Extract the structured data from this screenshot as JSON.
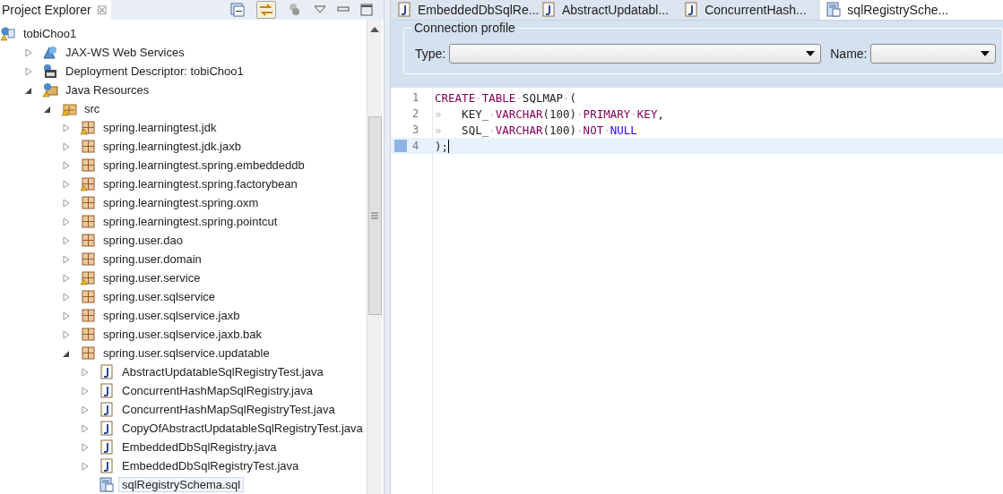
{
  "explorer": {
    "title": "Project Explorer",
    "close": "☒",
    "tree": [
      {
        "label": "tobiChoo1",
        "kind": "project",
        "expandable": false,
        "selected": false,
        "children": [
          {
            "label": "JAX-WS Web Services",
            "kind": "webservices",
            "expanded": false,
            "selected": false
          },
          {
            "label": "Deployment Descriptor: tobiChoo1",
            "kind": "descriptor",
            "expanded": false,
            "selected": false
          },
          {
            "label": "Java Resources",
            "kind": "resources",
            "expanded": true,
            "selected": false,
            "children": [
              {
                "label": "src",
                "kind": "src",
                "expanded": true,
                "selected": false,
                "children": [
                  {
                    "label": "spring.learningtest.jdk",
                    "kind": "package-warn",
                    "expanded": false,
                    "selected": false
                  },
                  {
                    "label": "spring.learningtest.jdk.jaxb",
                    "kind": "package",
                    "expanded": false,
                    "selected": false
                  },
                  {
                    "label": "spring.learningtest.spring.embeddeddb",
                    "kind": "package",
                    "expanded": false,
                    "selected": false
                  },
                  {
                    "label": "spring.learningtest.spring.factorybean",
                    "kind": "package-warn",
                    "expanded": false,
                    "selected": false
                  },
                  {
                    "label": "spring.learningtest.spring.oxm",
                    "kind": "package",
                    "expanded": false,
                    "selected": false
                  },
                  {
                    "label": "spring.learningtest.spring.pointcut",
                    "kind": "package",
                    "expanded": false,
                    "selected": false
                  },
                  {
                    "label": "spring.user.dao",
                    "kind": "package",
                    "expanded": false,
                    "selected": false
                  },
                  {
                    "label": "spring.user.domain",
                    "kind": "package",
                    "expanded": false,
                    "selected": false
                  },
                  {
                    "label": "spring.user.service",
                    "kind": "package-warn",
                    "expanded": false,
                    "selected": false
                  },
                  {
                    "label": "spring.user.sqlservice",
                    "kind": "package",
                    "expanded": false,
                    "selected": false
                  },
                  {
                    "label": "spring.user.sqlservice.jaxb",
                    "kind": "package",
                    "expanded": false,
                    "selected": false
                  },
                  {
                    "label": "spring.user.sqlservice.jaxb.bak",
                    "kind": "package",
                    "expanded": false,
                    "selected": false
                  },
                  {
                    "label": "spring.user.sqlservice.updatable",
                    "kind": "package",
                    "expanded": true,
                    "selected": false,
                    "children": [
                      {
                        "label": "AbstractUpdatableSqlRegistryTest.java",
                        "kind": "java",
                        "expanded": false,
                        "selected": false
                      },
                      {
                        "label": "ConcurrentHashMapSqlRegistry.java",
                        "kind": "java",
                        "expanded": false,
                        "selected": false
                      },
                      {
                        "label": "ConcurrentHashMapSqlRegistryTest.java",
                        "kind": "java",
                        "expanded": false,
                        "selected": false
                      },
                      {
                        "label": "CopyOfAbstractUpdatableSqlRegistryTest.java",
                        "kind": "java",
                        "expanded": false,
                        "selected": false
                      },
                      {
                        "label": "EmbeddedDbSqlRegistry.java",
                        "kind": "java",
                        "expanded": false,
                        "selected": false
                      },
                      {
                        "label": "EmbeddedDbSqlRegistryTest.java",
                        "kind": "java",
                        "expanded": false,
                        "selected": false
                      },
                      {
                        "label": "sqlRegistrySchema.sql",
                        "kind": "sql",
                        "expandable": false,
                        "selected": true
                      }
                    ]
                  }
                ]
              }
            ]
          }
        ]
      }
    ]
  },
  "editor": {
    "tabs": [
      {
        "label": "EmbeddedDbSqlRe...",
        "kind": "java",
        "selected": false
      },
      {
        "label": "AbstractUpdatabl...",
        "kind": "java",
        "selected": false
      },
      {
        "label": "ConcurrentHash...",
        "kind": "java",
        "selected": false
      },
      {
        "label": "sqlRegistrySche...",
        "kind": "sql",
        "selected": true
      }
    ],
    "connection_profile": {
      "title": "Connection profile",
      "type_label": "Type:",
      "name_label": "Name:"
    },
    "lines": [
      {
        "number": "1",
        "current": false,
        "tokens": [
          {
            "text": "CREATE",
            "kind": "keyword"
          },
          {
            "text": "·",
            "kind": "ws"
          },
          {
            "text": "TABLE",
            "kind": "keyword"
          },
          {
            "text": "·",
            "kind": "ws"
          },
          {
            "text": "SQLMAP",
            "kind": "plain"
          },
          {
            "text": "·",
            "kind": "ws"
          },
          {
            "text": "(",
            "kind": "plain"
          }
        ]
      },
      {
        "number": "2",
        "current": false,
        "tokens": [
          {
            "text": "»   ",
            "kind": "ws"
          },
          {
            "text": "KEY_",
            "kind": "plain"
          },
          {
            "text": "·",
            "kind": "ws"
          },
          {
            "text": "VARCHAR",
            "kind": "keyword"
          },
          {
            "text": "(100)",
            "kind": "plain"
          },
          {
            "text": "·",
            "kind": "ws"
          },
          {
            "text": "PRIMARY",
            "kind": "keyword"
          },
          {
            "text": "·",
            "kind": "ws"
          },
          {
            "text": "KEY",
            "kind": "keyword"
          },
          {
            "text": ",",
            "kind": "plain"
          }
        ]
      },
      {
        "number": "3",
        "current": false,
        "tokens": [
          {
            "text": "»   ",
            "kind": "ws"
          },
          {
            "text": "SQL_",
            "kind": "plain"
          },
          {
            "text": "·",
            "kind": "ws"
          },
          {
            "text": "VARCHAR",
            "kind": "keyword"
          },
          {
            "text": "(100)",
            "kind": "plain"
          },
          {
            "text": "·",
            "kind": "ws"
          },
          {
            "text": "NOT",
            "kind": "keyword"
          },
          {
            "text": "·",
            "kind": "ws"
          },
          {
            "text": "NULL",
            "kind": "literal"
          }
        ]
      },
      {
        "number": "4",
        "current": true,
        "tokens": [
          {
            "text": ");",
            "kind": "plain"
          }
        ]
      }
    ]
  }
}
